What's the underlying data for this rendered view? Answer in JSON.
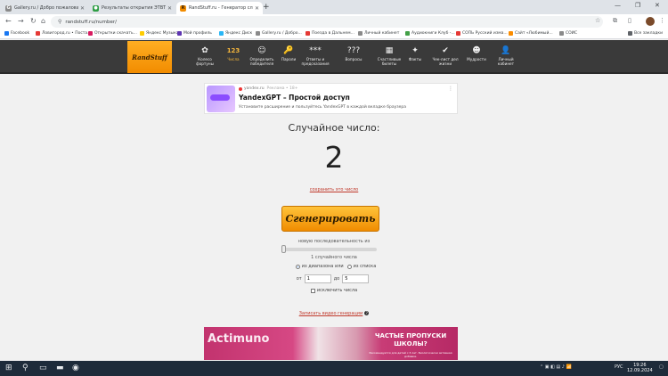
{
  "browser": {
    "tabs": [
      {
        "label": "Gallery.ru / Добро пожаловать",
        "favicon": "G",
        "favicon_color": "#8a8a8a",
        "active": false
      },
      {
        "label": "Результаты открытия ЭТВТМ",
        "favicon": "●",
        "favicon_color": "#2e9e44",
        "active": false
      },
      {
        "label": "RandStuff.ru - Генератор случ...",
        "favicon": "R",
        "favicon_color": "#f28c00",
        "active": true
      }
    ],
    "new_tab": "+",
    "url": "randstuff.ru/number/",
    "bookmarks": [
      {
        "label": "Facebook",
        "color": "#1877f2"
      },
      {
        "label": "Ловигород.ru • Поста...",
        "color": "#e53935"
      },
      {
        "label": "Открытки скачать...",
        "color": "#d81b60"
      },
      {
        "label": "Яндекс Музыка",
        "color": "#ffcc00"
      },
      {
        "label": "Мой профиль",
        "color": "#5e35b1"
      },
      {
        "label": "Яндекс Диск",
        "color": "#29b6f6"
      },
      {
        "label": "Gallery.ru / Добро...",
        "color": "#8a8a8a"
      },
      {
        "label": "Поезда в Дальнем...",
        "color": "#e53935"
      },
      {
        "label": "Личный кабинет",
        "color": "#8a8a8a"
      },
      {
        "label": "Аудиокниги Клуб -...",
        "color": "#43a047"
      },
      {
        "label": "СОПЬ Русский изма...",
        "color": "#e53935"
      },
      {
        "label": "Сайт «Любимый...",
        "color": "#fb8c00"
      },
      {
        "label": "СОИС",
        "color": "#8a8a8a"
      }
    ],
    "all_bookmarks": "Все закладки"
  },
  "site": {
    "logo": "RandStuff",
    "nav": [
      {
        "label": "Колесо фортуны",
        "icon": "✿",
        "current": false
      },
      {
        "label": "Числа",
        "icon": "123",
        "current": true
      },
      {
        "label": "Определить победителя",
        "icon": "☺",
        "current": false
      },
      {
        "label": "Пароли",
        "icon": "🔑",
        "current": false
      },
      {
        "label": "Ответы и предсказания",
        "icon": "***",
        "current": false
      },
      {
        "label": "Вопросы",
        "icon": "???",
        "current": false
      },
      {
        "label": "Счастливые билеты",
        "icon": "▦",
        "current": false
      },
      {
        "label": "Факты",
        "icon": "✦",
        "current": false
      },
      {
        "label": "Чек-лист дел жизни",
        "icon": "✔",
        "current": false
      },
      {
        "label": "Мудрости",
        "icon": "☻",
        "current": false
      },
      {
        "label": "Личный кабинет",
        "icon": "👤",
        "current": false
      }
    ]
  },
  "ad_top": {
    "source": "yandex.ru",
    "source_note": "Реклама • 18+",
    "title": "YandexGPT – Простой доступ",
    "text": "Установите расширение и пользуйтесь YandexGPT в каждой вкладке браузера",
    "menu": "⋮"
  },
  "generator": {
    "heading": "Случайное число:",
    "result": "2",
    "save_link": "сохранить это число",
    "generate_button": "Сгенерировать",
    "sequence_label": "новую последовательность из",
    "count": 1,
    "count_max": 100,
    "count_label": "1 случайного числа",
    "range_option": "из диапазона",
    "list_or": "или",
    "list_option": "из списка",
    "from_label": "от",
    "from_value": "1",
    "to_label": "до",
    "to_value": "5",
    "exclude_label": "исключить числа",
    "video_link": "Записать видео генерации",
    "help": "?"
  },
  "ad_bottom": {
    "brand": "Actimuno",
    "slogan": "ЧАСТЫЕ ПРОПУСКИ ШКОЛЫ?",
    "fine": "Рекомендуется для детей с 3 лет. Биологически активная добавка."
  },
  "taskbar": {
    "lang": "РУС",
    "time": "19:26",
    "date": "12.09.2024"
  }
}
